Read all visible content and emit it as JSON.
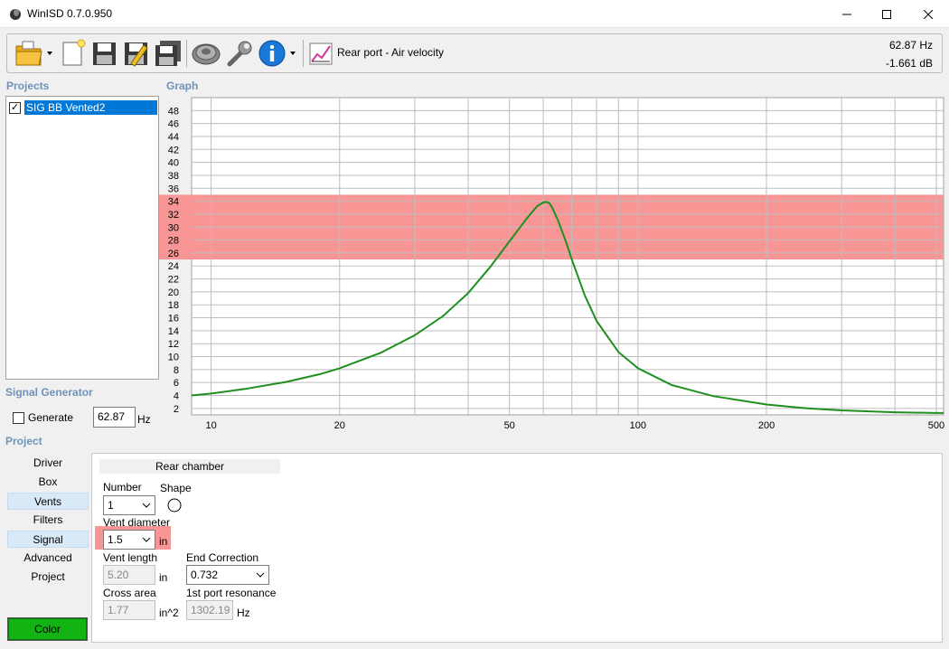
{
  "window": {
    "title": "WinISD 0.7.0.950",
    "minimize_glyph": "—",
    "maximize_glyph": "☐",
    "close_glyph": "✕"
  },
  "toolbar": {
    "graph_title": "Rear port - Air velocity",
    "frequency": "62.87 Hz",
    "level": "-1.661 dB",
    "icons": [
      "open-folder-icon",
      "new-document-icon",
      "save-icon",
      "save-as-icon",
      "save-all-icon",
      "speaker-driver-icon",
      "wrench-icon",
      "info-icon",
      "graph-chart-icon"
    ]
  },
  "projects": {
    "header": "Projects",
    "items": [
      {
        "label": "SIG BB Vented2",
        "checked": true
      }
    ]
  },
  "graph": {
    "header": "Graph",
    "highlight_band": {
      "from": 25,
      "to": 35,
      "color": "#f89696"
    },
    "curve_color": "#1f8f1f"
  },
  "chart_data": {
    "type": "line",
    "title": "",
    "xlabel": "",
    "ylabel": "",
    "x_scale": "log",
    "xlim": [
      9,
      520
    ],
    "ylim": [
      1,
      50
    ],
    "x_ticks": [
      10,
      20,
      50,
      100,
      200,
      500
    ],
    "y_ticks": [
      2,
      4,
      6,
      8,
      10,
      12,
      14,
      16,
      18,
      20,
      22,
      24,
      26,
      28,
      30,
      32,
      34,
      36,
      38,
      40,
      42,
      44,
      46,
      48
    ],
    "grid": true,
    "series": [
      {
        "color": "#1f8f1f",
        "x": [
          9,
          10,
          12,
          15,
          18,
          20,
          25,
          30,
          35,
          40,
          45,
          50,
          55,
          58,
          60,
          61,
          62,
          63,
          65,
          68,
          70,
          75,
          80,
          90,
          100,
          120,
          150,
          200,
          250,
          300,
          400,
          500,
          520
        ],
        "y": [
          4.0,
          4.3,
          5.0,
          6.1,
          7.3,
          8.2,
          10.6,
          13.3,
          16.3,
          19.8,
          23.8,
          27.8,
          31.4,
          33.2,
          33.8,
          33.9,
          33.7,
          33.0,
          31.0,
          27.5,
          25.0,
          19.5,
          15.5,
          10.7,
          8.2,
          5.6,
          3.9,
          2.6,
          2.0,
          1.7,
          1.4,
          1.3,
          1.3
        ]
      }
    ]
  },
  "signal_generator": {
    "header": "Signal Generator",
    "generate_label": "Generate",
    "generate_checked": false,
    "frequency_value": "62.87",
    "unit": "Hz"
  },
  "project_panel": {
    "header": "Project",
    "nav": [
      {
        "label": "Driver",
        "selected": false
      },
      {
        "label": "Box",
        "selected": false
      },
      {
        "label": "Vents",
        "selected": true
      },
      {
        "label": "Filters",
        "selected": false
      },
      {
        "label": "Signal",
        "selected": true
      },
      {
        "label": "Advanced",
        "selected": false
      },
      {
        "label": "Project",
        "selected": false
      }
    ],
    "color_button": "Color",
    "color_value": "#14b314"
  },
  "vents": {
    "section_title": "Rear chamber",
    "number_label": "Number",
    "number_value": "1",
    "shape_label": "Shape",
    "vent_diameter_label": "Vent diameter",
    "vent_diameter_value": "1.5",
    "vent_diameter_unit": "in",
    "vent_length_label": "Vent length",
    "vent_length_value": "5.20",
    "vent_length_unit": "in",
    "end_correction_label": "End Correction",
    "end_correction_value": "0.732",
    "cross_area_label": "Cross area",
    "cross_area_value": "1.77",
    "cross_area_unit": "in^2",
    "port_resonance_label": "1st port resonance",
    "port_resonance_value": "1302.19",
    "port_resonance_unit": "Hz"
  }
}
